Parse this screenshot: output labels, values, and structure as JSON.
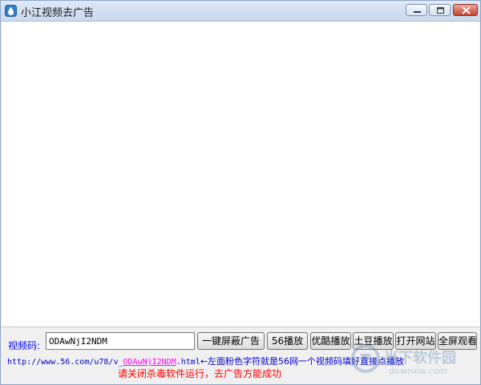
{
  "window": {
    "title": "小江视频去广告",
    "icon": "droplet-app-icon"
  },
  "controls": {
    "code_label": "视频码:",
    "code_value": "ODAwNjI2NDM",
    "buttons": {
      "block_ads": "一键屏蔽广告",
      "play_56": "56播放",
      "play_youku": "优酷播放",
      "play_tudou": "土豆播放",
      "open_site": "打开网站",
      "fullscreen": "全屏观看"
    }
  },
  "hint": {
    "url_prefix": "http://www.56.com/u78/v_",
    "url_code": "ODAwNjI2NDM",
    "url_suffix": ".html",
    "note": "←左面粉色字符就是56网一个视频码填好直接点播放",
    "warning": "请关闭杀毒软件运行，去广告方能成功"
  },
  "watermark": {
    "cn": "当下软件园",
    "en": "downxia.com"
  },
  "colors": {
    "label_blue": "#0000ff",
    "url_blue": "#0000cc",
    "code_pink": "#ff00ff",
    "warning_red": "#ff0000",
    "close_red": "#c6432f"
  }
}
